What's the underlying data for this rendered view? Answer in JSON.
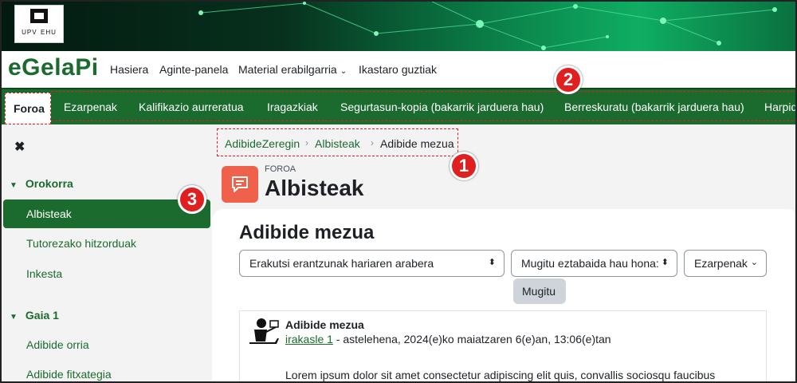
{
  "logo": {
    "brand_left": "UPV",
    "brand_right": "EHU"
  },
  "navbar": {
    "site_name": "eGelaPi",
    "links": [
      "Hasiera",
      "Aginte-panela",
      "Material erabilgarria",
      "Ikastaro guztiak"
    ]
  },
  "secondary_nav": {
    "active": "Foroa",
    "items": [
      "Ezarpenak",
      "Kalifikazio aurreratua",
      "Iragazkiak",
      "Segurtasun-kopia (bakarrik jarduera hau)",
      "Berreskuratu (bakarrik jarduera hau)",
      "Harpid"
    ]
  },
  "sidebar": {
    "close_glyph": "✖",
    "sections": [
      {
        "title": "Orokorra",
        "items": [
          "Albisteak",
          "Tutorezako hitzorduak",
          "Inkesta"
        ]
      },
      {
        "title": "Gaia 1",
        "items": [
          "Adibide orria",
          "Adibide fitxategia"
        ]
      }
    ],
    "active_item": "Albisteak"
  },
  "breadcrumb": [
    "AdibideZeregin",
    "Albisteak",
    "Adibide mezua"
  ],
  "module": {
    "type_label": "FOROA",
    "title": "Albisteak",
    "icon": "forum-icon",
    "icon_color": "#f0614b"
  },
  "discussion": {
    "title": "Adibide mezua",
    "display_mode": "Erakutsi erantzunak hariaren arabera",
    "move_select": "Mugitu eztabaida hau hona:",
    "settings_label": "Ezarpenak",
    "move_button": "Mugitu"
  },
  "post": {
    "subject": "Adibide mezua",
    "author": "irakasle 1",
    "date": " - astelehena, 2024(e)ko maiatzaren 6(e)an, 13:06(e)tan",
    "body": "Lorem ipsum dolor sit amet consectetur adipiscing elit quis, convallis sociosqu faucibus"
  },
  "callouts": [
    "1",
    "2",
    "3"
  ],
  "colors": {
    "brand_green": "#1a6b2d",
    "callout_red": "#e02020"
  }
}
